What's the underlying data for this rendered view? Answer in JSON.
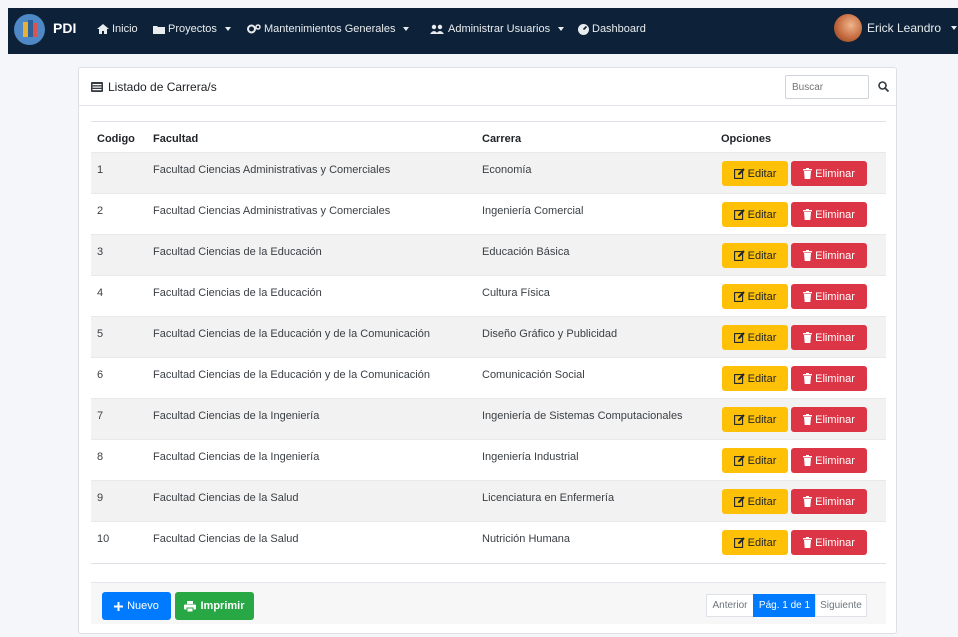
{
  "navbar": {
    "brand": "PDI",
    "items": [
      {
        "label": "Inicio",
        "icon": "home-icon"
      },
      {
        "label": "Proyectos",
        "icon": "folder-icon"
      },
      {
        "label": "Mantenimientos Generales",
        "icon": "cogs-icon"
      },
      {
        "label": "Administrar Usuarios",
        "icon": "users-icon"
      },
      {
        "label": "Dashboard",
        "icon": "dashboard-icon"
      }
    ],
    "user_name": "Erick Leandro"
  },
  "card": {
    "title": "Listado de Carrera/s",
    "search_placeholder": "Buscar"
  },
  "table": {
    "headers": {
      "codigo": "Codigo",
      "facultad": "Facultad",
      "carrera": "Carrera",
      "opciones": "Opciones"
    },
    "edit_label": "Editar",
    "delete_label": "Eliminar",
    "rows": [
      {
        "codigo": "1",
        "facultad": "Facultad Ciencias Administrativas y Comerciales",
        "carrera": "Economía"
      },
      {
        "codigo": "2",
        "facultad": "Facultad Ciencias Administrativas y Comerciales",
        "carrera": "Ingeniería Comercial"
      },
      {
        "codigo": "3",
        "facultad": "Facultad Ciencias de la Educación",
        "carrera": "Educación Básica"
      },
      {
        "codigo": "4",
        "facultad": "Facultad Ciencias de la Educación",
        "carrera": "Cultura Física"
      },
      {
        "codigo": "5",
        "facultad": "Facultad Ciencias de la Educación y de la Comunicación",
        "carrera": "Diseño Gráfico y Publicidad"
      },
      {
        "codigo": "6",
        "facultad": "Facultad Ciencias de la Educación y de la Comunicación",
        "carrera": "Comunicación Social"
      },
      {
        "codigo": "7",
        "facultad": "Facultad Ciencias de la Ingeniería",
        "carrera": "Ingeniería de Sistemas Computacionales"
      },
      {
        "codigo": "8",
        "facultad": "Facultad Ciencias de la Ingeniería",
        "carrera": "Ingeniería Industrial"
      },
      {
        "codigo": "9",
        "facultad": "Facultad Ciencias de la Salud",
        "carrera": "Licenciatura en Enfermería"
      },
      {
        "codigo": "10",
        "facultad": "Facultad Ciencias de la Salud",
        "carrera": "Nutrición Humana"
      }
    ]
  },
  "footer": {
    "new_label": "Nuevo",
    "print_label": "Imprimir",
    "pager": {
      "prev": "Anterior",
      "current": "Pág. 1 de 1",
      "next": "Siguiente"
    }
  },
  "colors": {
    "navbar": "#0d2238",
    "edit": "#ffc107",
    "delete": "#dc3545",
    "new": "#007bff",
    "print": "#28a745"
  }
}
